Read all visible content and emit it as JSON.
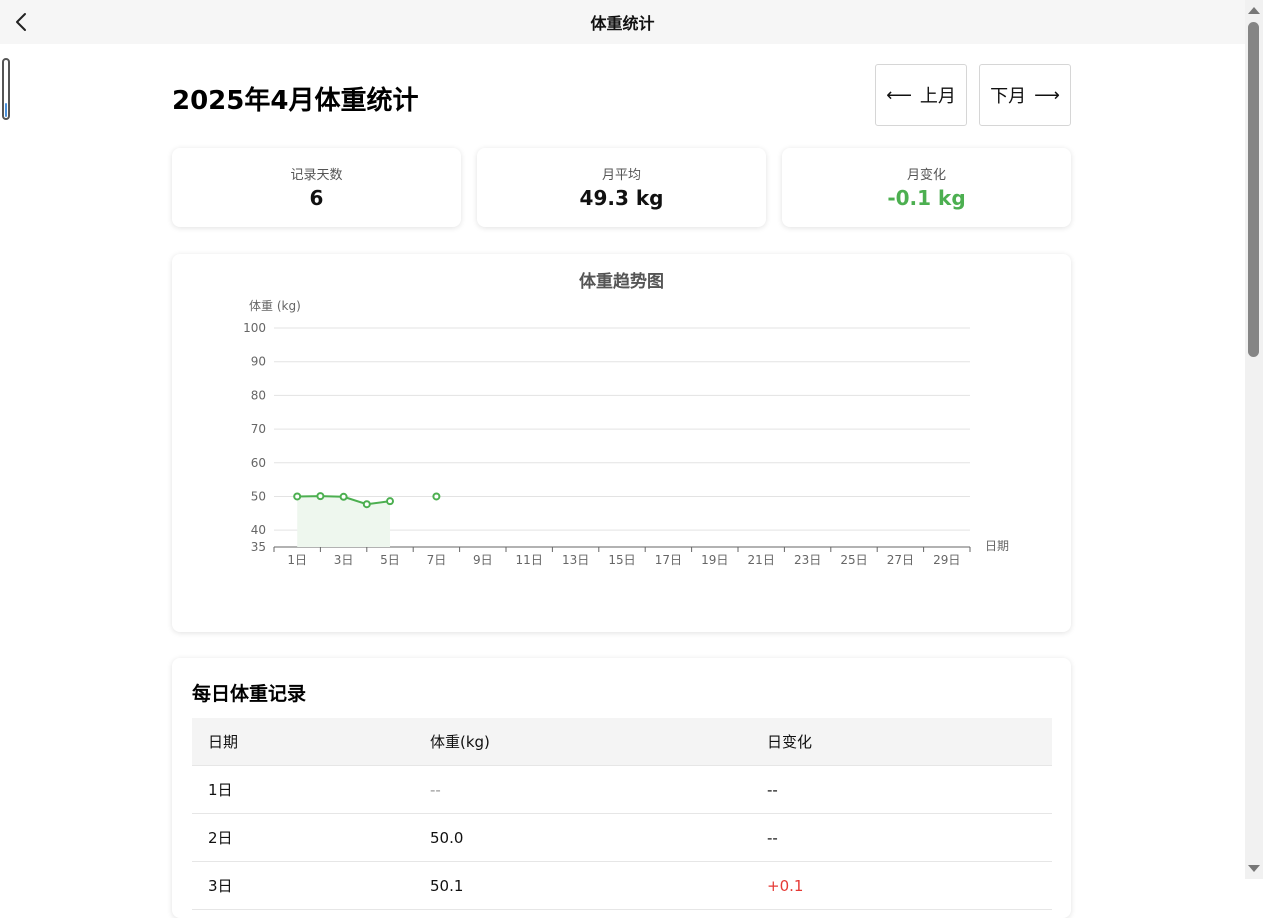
{
  "topbar": {
    "title": "体重统计"
  },
  "page": {
    "title": "2025年4月体重统计"
  },
  "nav": {
    "prev_label": "上月",
    "next_label": "下月",
    "prev_arrow": "⟵",
    "next_arrow": "⟶"
  },
  "stats": {
    "days": {
      "label": "记录天数",
      "value": "6"
    },
    "avg": {
      "label": "月平均",
      "value": "49.3 kg"
    },
    "change": {
      "label": "月变化",
      "value": "-0.1 kg",
      "color": "#4caf50"
    }
  },
  "chart_data": {
    "type": "line",
    "title": "体重趋势图",
    "ylabel": "体重 (kg)",
    "xlabel": "日期",
    "ylim": [
      35,
      100
    ],
    "xlim": [
      1,
      31
    ],
    "yticks": [
      "35",
      "40",
      "50",
      "60",
      "70",
      "80",
      "90",
      "100"
    ],
    "xticks": [
      "1日",
      "3日",
      "5日",
      "7日",
      "9日",
      "11日",
      "13日",
      "15日",
      "17日",
      "19日",
      "21日",
      "23日",
      "25日",
      "27日",
      "29日"
    ],
    "series": [
      {
        "x": [
          2,
          3,
          4,
          5,
          6
        ],
        "y": [
          50.0,
          50.1,
          49.9,
          47.7,
          48.6
        ],
        "color": "#4caf50",
        "fill": "#eef7ee"
      },
      {
        "x": [
          8
        ],
        "y": [
          50.0
        ],
        "color": "#4caf50"
      }
    ],
    "grid": true
  },
  "table": {
    "title": "每日体重记录",
    "headers": [
      "日期",
      "体重(kg)",
      "日变化"
    ],
    "rows": [
      [
        "1日",
        "--",
        "--"
      ],
      [
        "2日",
        "50.0",
        "--"
      ],
      [
        "3日",
        "50.1",
        "+0.1"
      ]
    ]
  }
}
